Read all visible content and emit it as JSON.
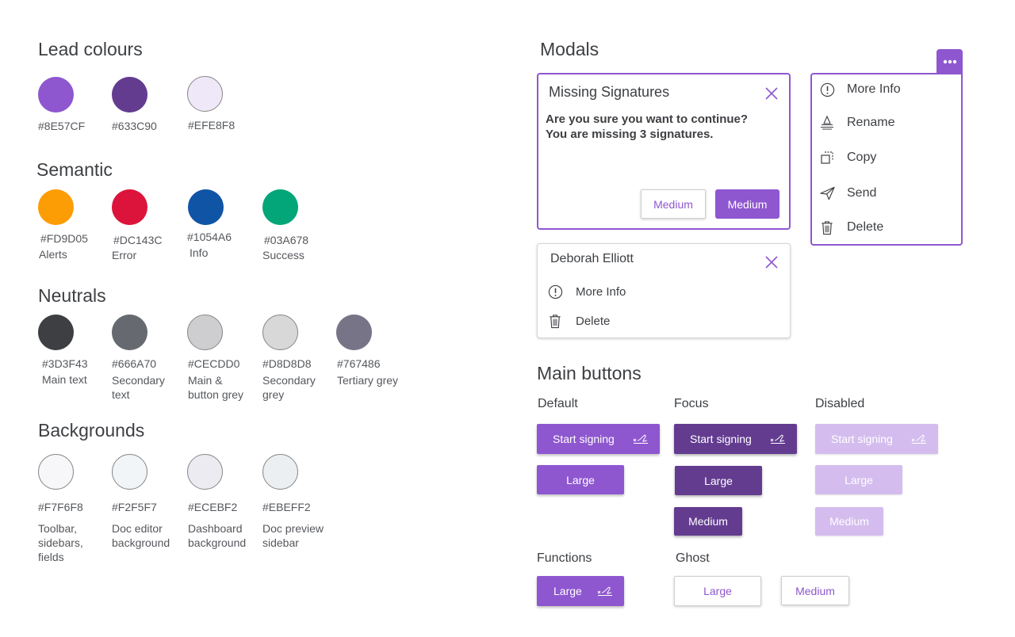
{
  "lead": {
    "title": "Lead colours",
    "swatches": [
      {
        "hex": "#8E57CF"
      },
      {
        "hex": "#633C90"
      },
      {
        "hex": "#EFE8F8"
      }
    ]
  },
  "semantic": {
    "title": "Semantic",
    "swatches": [
      {
        "hex": "#FD9D05",
        "label": "Alerts"
      },
      {
        "hex": "#DC143C",
        "label": "Error"
      },
      {
        "hex": "#1054A6",
        "label": "Info"
      },
      {
        "hex": "#03A678",
        "label": "Success"
      }
    ]
  },
  "neutrals": {
    "title": "Neutrals",
    "swatches": [
      {
        "hex": "#3D3F43",
        "label": "Main text"
      },
      {
        "hex": "#666A70",
        "label": "Secondary text"
      },
      {
        "hex": "#CECDD0",
        "label": "Main & button grey"
      },
      {
        "hex": "#D8D8D8",
        "label": "Secondary grey"
      },
      {
        "hex": "#767486",
        "label": "Tertiary grey"
      }
    ]
  },
  "backgrounds": {
    "title": "Backgrounds",
    "swatches": [
      {
        "hex": "#F7F6F8",
        "label": "Toolbar, sidebars, fields"
      },
      {
        "hex": "#F2F5F7",
        "label": "Doc editor background"
      },
      {
        "hex": "#ECEBF2",
        "label": "Dashboard background"
      },
      {
        "hex": "#EBEFF2",
        "label": "Doc preview sidebar"
      }
    ]
  },
  "modals": {
    "title": "Modals",
    "confirm": {
      "title": "Missing Signatures",
      "message": "Are you sure you want to continue? You are missing 3 signatures.",
      "secondary_label": "Medium",
      "primary_label": "Medium"
    },
    "contact": {
      "title": "Deborah Elliott",
      "items": [
        {
          "label": "More Info",
          "icon": "info-icon"
        },
        {
          "label": "Delete",
          "icon": "trash-icon"
        }
      ]
    },
    "menu": {
      "items": [
        {
          "label": "More Info",
          "icon": "info-icon"
        },
        {
          "label": "Rename",
          "icon": "rename-icon"
        },
        {
          "label": "Copy",
          "icon": "copy-icon"
        },
        {
          "label": "Send",
          "icon": "send-icon"
        },
        {
          "label": "Delete",
          "icon": "trash-icon"
        }
      ]
    }
  },
  "buttons": {
    "title": "Main buttons",
    "states": {
      "default": "Default",
      "focus": "Focus",
      "disabled": "Disabled",
      "functions": "Functions",
      "ghost": "Ghost"
    },
    "start_signing": "Start signing",
    "large": "Large",
    "medium": "Medium"
  },
  "colors": {
    "accent": "#8E57CF",
    "accent_dark": "#633C90",
    "accent_disabled": "#D4BDEE"
  }
}
